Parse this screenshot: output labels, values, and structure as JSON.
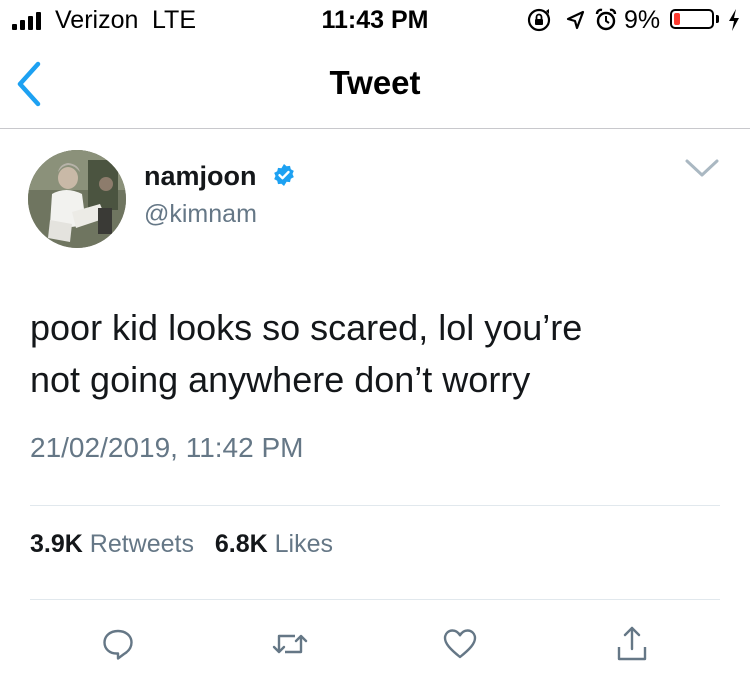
{
  "status_bar": {
    "carrier": "Verizon",
    "network": "LTE",
    "time": "11:43 PM",
    "battery_percent": "9%",
    "battery_level": 0.09,
    "battery_color": "#ff3b30",
    "icons": [
      "signal-icon",
      "rotation-lock-icon",
      "location-icon",
      "alarm-icon",
      "battery-icon",
      "charging-icon"
    ]
  },
  "nav": {
    "title": "Tweet",
    "back_icon": "chevron-left-icon",
    "accent_color": "#1da1f2"
  },
  "tweet": {
    "display_name": "namjoon",
    "handle": "@kimnam",
    "verified": true,
    "text_line1": "poor kid looks so scared, lol you’re",
    "text_line2": "not going anywhere don’t worry",
    "timestamp": "21/02/2019, 11:42 PM",
    "retweet_count": "3.9K",
    "retweet_label": "Retweets",
    "like_count": "6.8K",
    "like_label": "Likes"
  },
  "actions": [
    "reply-icon",
    "retweet-icon",
    "like-icon",
    "share-icon"
  ]
}
